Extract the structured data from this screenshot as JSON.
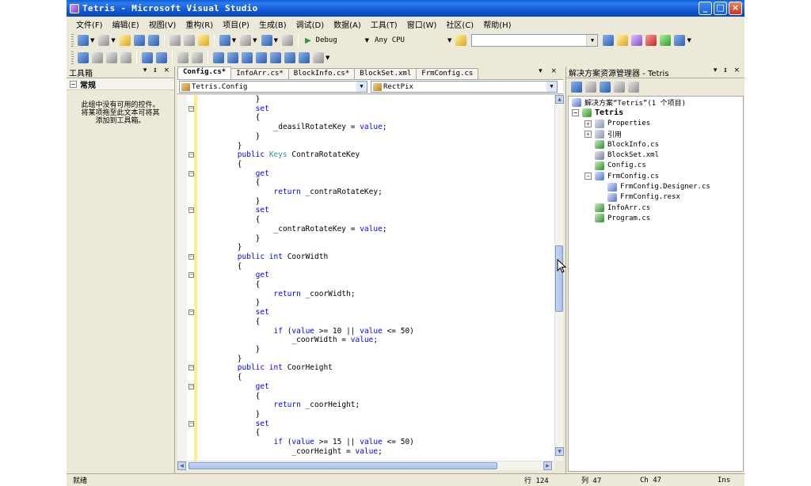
{
  "window": {
    "title": "Tetris - Microsoft Visual Studio",
    "controls": [
      "_",
      "□",
      "×"
    ]
  },
  "menu": [
    "文件(F)",
    "编辑(E)",
    "视图(V)",
    "重构(R)",
    "项目(P)",
    "生成(B)",
    "调试(D)",
    "数据(A)",
    "工具(T)",
    "窗口(W)",
    "社区(C)",
    "帮助(H)"
  ],
  "toolbar": {
    "config": "Debug",
    "platform": "Any CPU"
  },
  "toolbox": {
    "title": "工具箱",
    "controls": "▾ ᵻ ×",
    "group": "常规",
    "empty_text_1": "此组中没有可用的控件。",
    "empty_text_2": "将某项拖至此文本可将其",
    "empty_text_3": "添加到工具箱。"
  },
  "editor": {
    "tabs": [
      {
        "label": "Config.cs*",
        "active": true
      },
      {
        "label": "InfoArr.cs*",
        "active": false
      },
      {
        "label": "BlockInfo.cs*",
        "active": false
      },
      {
        "label": "BlockSet.xml",
        "active": false
      },
      {
        "label": "FrmConfig.cs",
        "active": false
      }
    ],
    "tab_controls": "▾ ×",
    "class_combo": "Tetris.Config",
    "member_combo": "RectPix",
    "lines": [
      {
        "indent": "            ",
        "parts": [
          [
            "",
            "}"
          ]
        ]
      },
      {
        "indent": "            ",
        "parts": [
          [
            "kw",
            "set"
          ]
        ]
      },
      {
        "indent": "            ",
        "parts": [
          [
            "",
            "{"
          ]
        ]
      },
      {
        "indent": "                ",
        "parts": [
          [
            "",
            "_deasilRotateKey = "
          ],
          [
            "kw",
            "value"
          ],
          [
            "",
            ";"
          ]
        ]
      },
      {
        "indent": "            ",
        "parts": [
          [
            "",
            "}"
          ]
        ]
      },
      {
        "indent": "        ",
        "parts": [
          [
            "",
            "}"
          ]
        ]
      },
      {
        "indent": "        ",
        "parts": [
          [
            "kw",
            "public "
          ],
          [
            "ty",
            "Keys"
          ],
          [
            "",
            " ContraRotateKey"
          ]
        ]
      },
      {
        "indent": "        ",
        "parts": [
          [
            "",
            "{"
          ]
        ]
      },
      {
        "indent": "            ",
        "parts": [
          [
            "kw",
            "get"
          ]
        ]
      },
      {
        "indent": "            ",
        "parts": [
          [
            "",
            "{"
          ]
        ]
      },
      {
        "indent": "                ",
        "parts": [
          [
            "kw",
            "return"
          ],
          [
            "",
            " _contraRotateKey;"
          ]
        ]
      },
      {
        "indent": "            ",
        "parts": [
          [
            "",
            "}"
          ]
        ]
      },
      {
        "indent": "            ",
        "parts": [
          [
            "kw",
            "set"
          ]
        ]
      },
      {
        "indent": "            ",
        "parts": [
          [
            "",
            "{"
          ]
        ]
      },
      {
        "indent": "                ",
        "parts": [
          [
            "",
            "_contraRotateKey = "
          ],
          [
            "kw",
            "value"
          ],
          [
            "",
            ";"
          ]
        ]
      },
      {
        "indent": "            ",
        "parts": [
          [
            "",
            "}"
          ]
        ]
      },
      {
        "indent": "        ",
        "parts": [
          [
            "",
            "}"
          ]
        ]
      },
      {
        "indent": "        ",
        "parts": [
          [
            "kw",
            "public int"
          ],
          [
            "",
            " CoorWidth"
          ]
        ]
      },
      {
        "indent": "        ",
        "parts": [
          [
            "",
            "{"
          ]
        ]
      },
      {
        "indent": "            ",
        "parts": [
          [
            "kw",
            "get"
          ]
        ]
      },
      {
        "indent": "            ",
        "parts": [
          [
            "",
            "{"
          ]
        ]
      },
      {
        "indent": "                ",
        "parts": [
          [
            "kw",
            "return"
          ],
          [
            "",
            " _coorWidth;"
          ]
        ]
      },
      {
        "indent": "            ",
        "parts": [
          [
            "",
            "}"
          ]
        ]
      },
      {
        "indent": "            ",
        "parts": [
          [
            "kw",
            "set"
          ]
        ]
      },
      {
        "indent": "            ",
        "parts": [
          [
            "",
            "{"
          ]
        ]
      },
      {
        "indent": "                ",
        "parts": [
          [
            "kw",
            "if"
          ],
          [
            "",
            " ("
          ],
          [
            "kw",
            "value"
          ],
          [
            "",
            " >= 10 || "
          ],
          [
            "kw",
            "value"
          ],
          [
            "",
            " <= 50)"
          ]
        ]
      },
      {
        "indent": "                    ",
        "parts": [
          [
            "",
            "_coorWidth = "
          ],
          [
            "kw",
            "value"
          ],
          [
            "",
            ";"
          ]
        ]
      },
      {
        "indent": "            ",
        "parts": [
          [
            "",
            "}"
          ]
        ]
      },
      {
        "indent": "        ",
        "parts": [
          [
            "",
            "}"
          ]
        ]
      },
      {
        "indent": "        ",
        "parts": [
          [
            "kw",
            "public int"
          ],
          [
            "",
            " CoorHeight"
          ]
        ]
      },
      {
        "indent": "        ",
        "parts": [
          [
            "",
            "{"
          ]
        ]
      },
      {
        "indent": "            ",
        "parts": [
          [
            "kw",
            "get"
          ]
        ]
      },
      {
        "indent": "            ",
        "parts": [
          [
            "",
            "{"
          ]
        ]
      },
      {
        "indent": "                ",
        "parts": [
          [
            "kw",
            "return"
          ],
          [
            "",
            " _coorHeight;"
          ]
        ]
      },
      {
        "indent": "            ",
        "parts": [
          [
            "",
            "}"
          ]
        ]
      },
      {
        "indent": "            ",
        "parts": [
          [
            "kw",
            "set"
          ]
        ]
      },
      {
        "indent": "            ",
        "parts": [
          [
            "",
            "{"
          ]
        ]
      },
      {
        "indent": "                ",
        "parts": [
          [
            "kw",
            "if"
          ],
          [
            "",
            " ("
          ],
          [
            "kw",
            "value"
          ],
          [
            "",
            " >= 15 || "
          ],
          [
            "kw",
            "value"
          ],
          [
            "",
            " <= 50)"
          ]
        ]
      },
      {
        "indent": "                    ",
        "parts": [
          [
            "",
            "_coorHeight = "
          ],
          [
            "kw",
            "value"
          ],
          [
            "",
            ";"
          ]
        ]
      }
    ]
  },
  "solution_explorer": {
    "title": "解决方案资源管理器 - Tetris",
    "controls": "▾ ᵻ ×",
    "nodes": [
      {
        "label": "解决方案“Tetris”(1 个项目)",
        "icon": "sln",
        "depth": 0,
        "expander": "",
        "bold": false
      },
      {
        "label": "Tetris",
        "icon": "proj",
        "depth": 0,
        "expander": "−",
        "bold": true
      },
      {
        "label": "Properties",
        "icon": "folder",
        "depth": 1,
        "expander": "+",
        "bold": false
      },
      {
        "label": "引用",
        "icon": "folder",
        "depth": 1,
        "expander": "+",
        "bold": false
      },
      {
        "label": "BlockInfo.cs",
        "icon": "cs",
        "depth": 1,
        "expander": "",
        "bold": false
      },
      {
        "label": "BlockSet.xml",
        "icon": "xml",
        "depth": 1,
        "expander": "",
        "bold": false
      },
      {
        "label": "Config.cs",
        "icon": "cs",
        "depth": 1,
        "expander": "",
        "bold": false
      },
      {
        "label": "FrmConfig.cs",
        "icon": "form",
        "depth": 1,
        "expander": "−",
        "bold": false
      },
      {
        "label": "FrmConfig.Designer.cs",
        "icon": "sub",
        "depth": 2,
        "expander": "",
        "bold": false
      },
      {
        "label": "FrmConfig.resx",
        "icon": "sub",
        "depth": 2,
        "expander": "",
        "bold": false
      },
      {
        "label": "InfoArr.cs",
        "icon": "cs",
        "depth": 1,
        "expander": "",
        "bold": false
      },
      {
        "label": "Program.cs",
        "icon": "cs",
        "depth": 1,
        "expander": "",
        "bold": false
      }
    ]
  },
  "status": {
    "ready": "就绪",
    "line": "行 124",
    "col": "列 47",
    "ch": "Ch 47",
    "mode": "Ins"
  },
  "colors": {
    "keyword": "#0000ff",
    "type": "#2b91af",
    "chrome": "#ece9d8",
    "titlebar": "#0b44bd"
  }
}
